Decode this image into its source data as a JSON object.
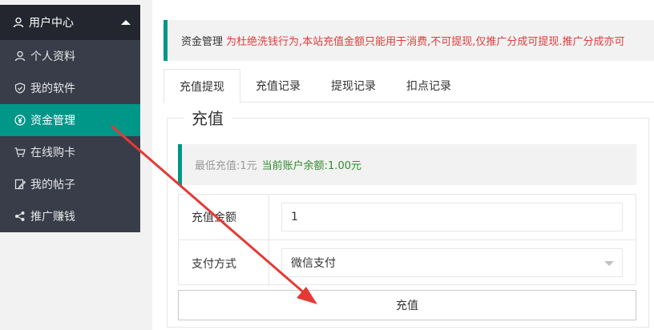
{
  "sidebar": {
    "header": {
      "label": "用户中心",
      "icon": "user-icon"
    },
    "items": [
      {
        "label": "个人资料",
        "icon": "user-icon",
        "active": false
      },
      {
        "label": "我的软件",
        "icon": "shield-icon",
        "active": false
      },
      {
        "label": "资金管理",
        "icon": "yen-icon",
        "active": true
      },
      {
        "label": "在线购卡",
        "icon": "cart-icon",
        "active": false
      },
      {
        "label": "我的帖子",
        "icon": "edit-icon",
        "active": false
      },
      {
        "label": "推广赚钱",
        "icon": "share-icon",
        "active": false
      }
    ]
  },
  "notice": {
    "title": "资金管理",
    "text": "为杜绝洗钱行为,本站充值金额只能用于消费,不可提现,仅推广分成可提现.推广分成亦可"
  },
  "tabs": [
    {
      "label": "充值提现",
      "active": true
    },
    {
      "label": "充值记录",
      "active": false
    },
    {
      "label": "提现记录",
      "active": false
    },
    {
      "label": "扣点记录",
      "active": false
    }
  ],
  "recharge": {
    "legend": "充值",
    "min_text": "最低充值:1元",
    "balance_text": "当前账户余额:1.00元",
    "amount_label": "充值金额",
    "amount_value": "1",
    "pay_label": "支付方式",
    "pay_value": "微信支付",
    "submit_label": "充值"
  },
  "colors": {
    "accent": "#009688",
    "sidebar_bg": "#393d49",
    "sidebar_head_bg": "#23262e",
    "notice_red": "#e03c3c",
    "balance_green": "#2f8a2f",
    "annotation_arrow": "#e53935"
  }
}
